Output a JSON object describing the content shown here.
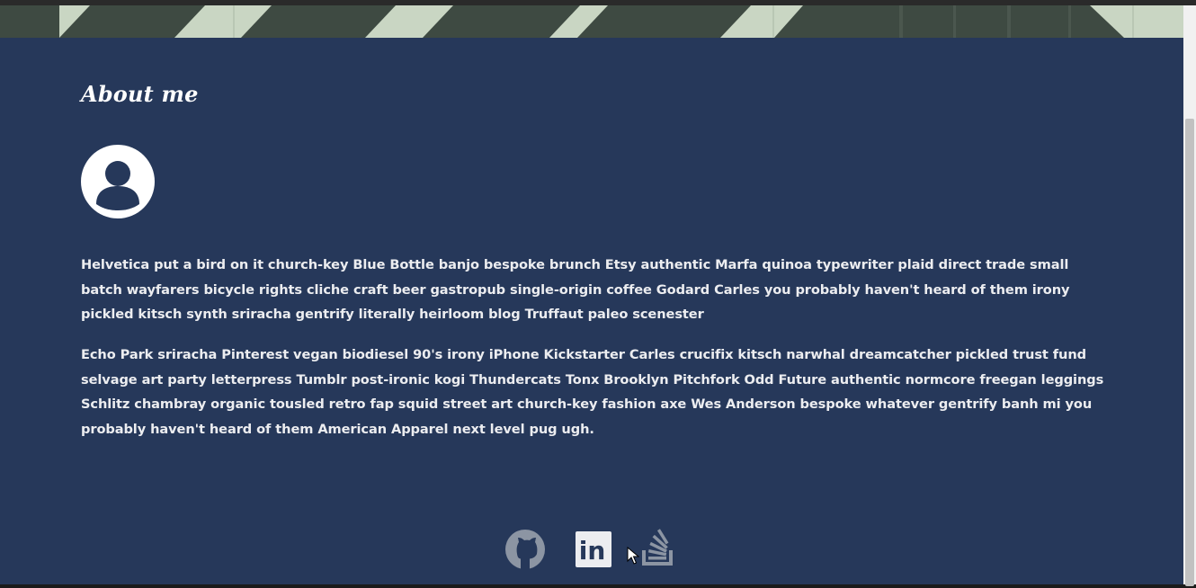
{
  "about": {
    "heading": "About me",
    "avatar_icon": "user-avatar-icon",
    "paragraphs": [
      "Helvetica put a bird on it church-key Blue Bottle banjo bespoke brunch Etsy authentic Marfa quinoa typewriter plaid direct trade small batch wayfarers bicycle rights cliche craft beer gastropub single-origin coffee Godard Carles you probably haven't heard of them irony pickled kitsch synth sriracha gentrify literally heirloom blog Truffaut paleo scenester",
      "Echo Park sriracha Pinterest vegan biodiesel 90's irony iPhone Kickstarter Carles crucifix kitsch narwhal dreamcatcher pickled trust fund selvage art party letterpress Tumblr post-ironic kogi Thundercats Tonx Brooklyn Pitchfork Odd Future authentic normcore freegan leggings Schlitz chambray organic tousled retro fap squid street art church-key fashion axe Wes Anderson bespoke whatever gentrify banh mi you probably haven't heard of them American Apparel next level pug ugh."
    ]
  },
  "social": {
    "links": [
      {
        "icon": "github-icon"
      },
      {
        "icon": "linkedin-icon",
        "text": "in"
      },
      {
        "icon": "stackoverflow-icon"
      }
    ]
  },
  "colors": {
    "page_background": "#26385a",
    "text": "#ecedf0",
    "heading": "#ffffff",
    "banner_light": "#c9d6c3",
    "banner_dark": "#3e4a42",
    "icon_gray": "#8c95a3"
  }
}
